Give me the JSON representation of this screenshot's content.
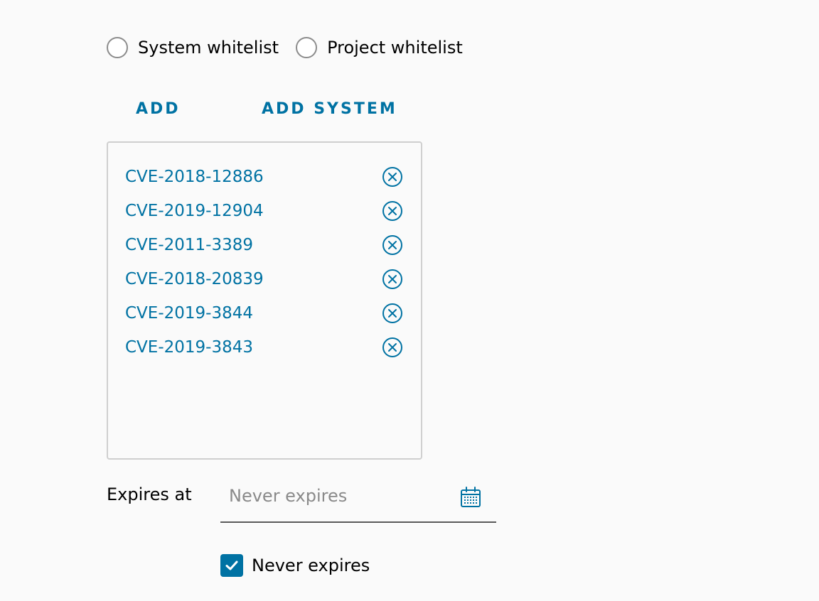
{
  "whitelist_scope": {
    "options": [
      {
        "label": "System whitelist",
        "selected": false
      },
      {
        "label": "Project whitelist",
        "selected": false
      }
    ]
  },
  "actions": {
    "add_label": "ADD",
    "add_system_label": "ADD SYSTEM"
  },
  "cve_list": [
    {
      "id": "CVE-2018-12886",
      "remove_icon": "close-circle-icon"
    },
    {
      "id": "CVE-2019-12904",
      "remove_icon": "close-circle-icon"
    },
    {
      "id": "CVE-2011-3389",
      "remove_icon": "close-circle-icon"
    },
    {
      "id": "CVE-2018-20839",
      "remove_icon": "close-circle-icon"
    },
    {
      "id": "CVE-2019-3844",
      "remove_icon": "close-circle-icon"
    },
    {
      "id": "CVE-2019-3843",
      "remove_icon": "close-circle-icon"
    }
  ],
  "expires": {
    "label": "Expires at",
    "value": "",
    "placeholder": "Never expires",
    "icon": "calendar-icon"
  },
  "never_expires": {
    "label": "Never expires",
    "checked": true
  },
  "colors": {
    "accent": "#0072a3",
    "background": "#fafafa",
    "border": "#cfcfcf",
    "placeholder": "#8a8a8a"
  }
}
